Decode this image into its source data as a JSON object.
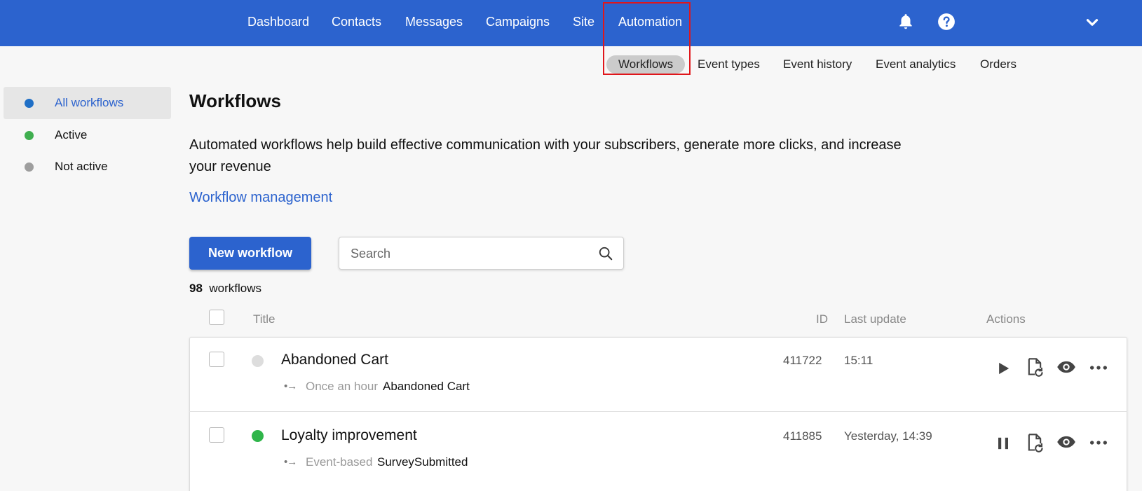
{
  "topnav": {
    "items": [
      "Dashboard",
      "Contacts",
      "Messages",
      "Campaigns",
      "Site",
      "Automation"
    ],
    "active": "Automation",
    "icons": [
      "bell-icon",
      "help-icon",
      "chevron-down-icon"
    ]
  },
  "subnav": {
    "items": [
      "Workflows",
      "Event types",
      "Event history",
      "Event analytics",
      "Orders"
    ],
    "active": "Workflows"
  },
  "sidebar": {
    "items": [
      {
        "label": "All workflows",
        "dot_color": "#1f6fc6",
        "active": true
      },
      {
        "label": "Active",
        "dot_color": "#3fae4f",
        "active": false
      },
      {
        "label": "Not active",
        "dot_color": "#9e9e9e",
        "active": false
      }
    ]
  },
  "main": {
    "title": "Workflows",
    "description": "Automated workflows help build effective communication with your subscribers, generate more clicks, and increase your revenue",
    "link_label": "Workflow management",
    "new_button_label": "New workflow",
    "search_placeholder": "Search",
    "count": "98",
    "count_suffix": "workflows"
  },
  "table": {
    "headers": {
      "title": "Title",
      "id": "ID",
      "last_update": "Last update",
      "actions": "Actions"
    },
    "rows": [
      {
        "title": "Abandoned Cart",
        "status": "inactive",
        "status_color": "#dddddd",
        "trigger_icon": "•→",
        "trigger": "Once an hour",
        "event": "Abandoned Cart",
        "id": "411722",
        "last_update": "15:11",
        "primary_action": "play-icon"
      },
      {
        "title": "Loyalty improvement",
        "status": "active",
        "status_color": "#2fb54a",
        "trigger_icon": "•→",
        "trigger": "Event-based",
        "event": "SurveySubmitted",
        "id": "411885",
        "last_update": "Yesterday, 14:39",
        "primary_action": "pause-icon"
      }
    ]
  },
  "colors": {
    "brand": "#2c63ce",
    "highlight": "#e0161b"
  }
}
